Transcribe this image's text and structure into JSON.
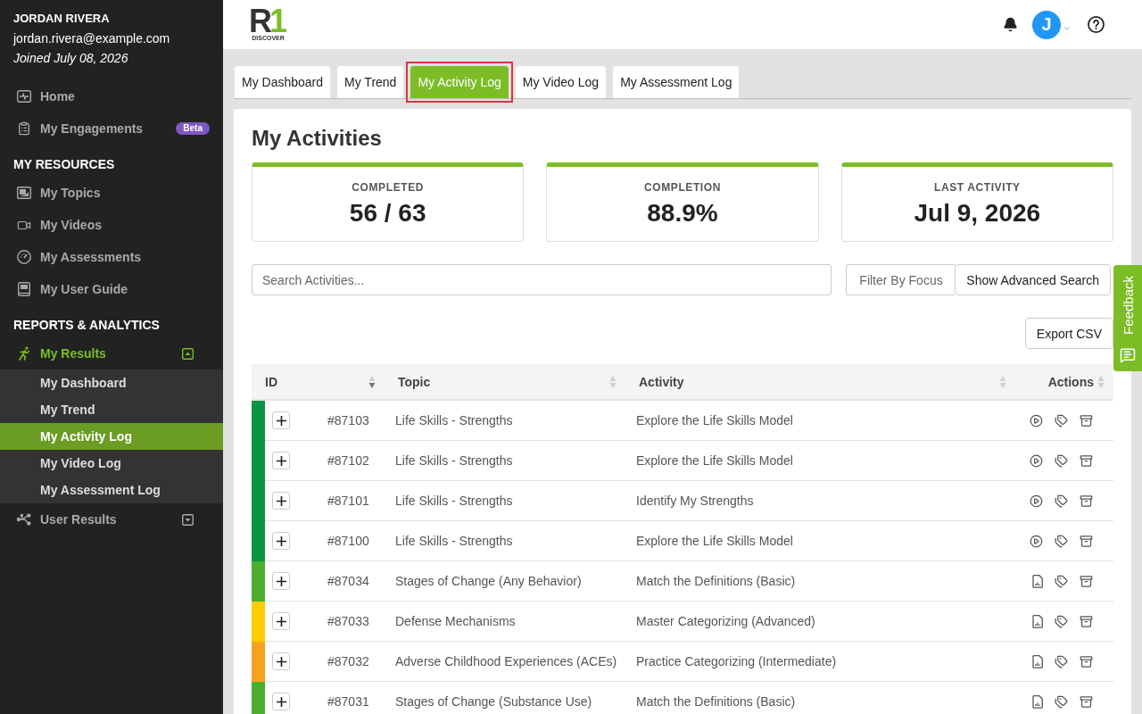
{
  "sidebar": {
    "user": {
      "name": "JORDAN RIVERA",
      "email": "jordan.rivera@example.com",
      "joined": "Joined July 08, 2026"
    },
    "sections": [
      {
        "items": [
          {
            "label": "Home",
            "selected": false
          },
          {
            "label": "My Engagements",
            "selected": false,
            "badge": "Beta"
          }
        ]
      },
      {
        "title": "MY RESOURCES",
        "items": [
          {
            "label": "My Topics",
            "selected": false
          },
          {
            "label": "My Videos",
            "selected": false
          },
          {
            "label": "My Assessments",
            "selected": false
          },
          {
            "label": "My User Guide",
            "selected": false
          }
        ]
      },
      {
        "title": "REPORTS & ANALYTICS",
        "items": [
          {
            "label": "My Results",
            "selected": true,
            "expanded": true,
            "children": [
              {
                "label": "My Dashboard",
                "selected": false
              },
              {
                "label": "My Trend",
                "selected": false
              },
              {
                "label": "My Activity Log",
                "selected": true
              },
              {
                "label": "My Video Log",
                "selected": false
              },
              {
                "label": "My Assessment Log",
                "selected": false
              }
            ]
          },
          {
            "label": "User Results",
            "selected": false,
            "expanded": false
          }
        ]
      }
    ]
  },
  "header": {
    "logo": {
      "letters": [
        {
          "char": "R",
          "color": "#333333"
        },
        {
          "char": "1",
          "color": "#7cbd26"
        }
      ],
      "wordmark": "DISCOVER"
    },
    "avatar_initial": "J"
  },
  "tabs": [
    {
      "label": "My Dashboard",
      "selected": false,
      "outlined": false
    },
    {
      "label": "My Trend",
      "selected": false,
      "outlined": false
    },
    {
      "label": "My Activity Log",
      "selected": true,
      "outlined": true
    },
    {
      "label": "My Video Log",
      "selected": false,
      "outlined": false
    },
    {
      "label": "My Assessment Log",
      "selected": false,
      "outlined": false
    }
  ],
  "page_title": "My Activities",
  "stats": [
    {
      "label": "COMPLETED",
      "value": "56 / 63"
    },
    {
      "label": "COMPLETION",
      "value": "88.9%"
    },
    {
      "label": "LAST ACTIVITY",
      "value": "Jul 9, 2026"
    }
  ],
  "search": {
    "placeholder": "Search Activities..."
  },
  "filter": {
    "placeholder": "Filter By Focus"
  },
  "buttons": {
    "advanced_search": "Show Advanced Search",
    "export": "Export CSV"
  },
  "table": {
    "columns": [
      {
        "label": "ID",
        "sorted": true
      },
      {
        "label": "Topic",
        "sorted": false
      },
      {
        "label": "Activity",
        "sorted": false
      },
      {
        "label": "Actions",
        "sorted": false
      }
    ],
    "rows": [
      {
        "id": "#87103",
        "topic": "Life Skills - Strengths",
        "activity": "Explore the Life Skills Model",
        "color": "#0b9444",
        "kind": "video"
      },
      {
        "id": "#87102",
        "topic": "Life Skills - Strengths",
        "activity": "Explore the Life Skills Model",
        "color": "#0b9444",
        "kind": "video"
      },
      {
        "id": "#87101",
        "topic": "Life Skills - Strengths",
        "activity": "Identify My Strengths",
        "color": "#0b9444",
        "kind": "video"
      },
      {
        "id": "#87100",
        "topic": "Life Skills - Strengths",
        "activity": "Explore the Life Skills Model",
        "color": "#0b9444",
        "kind": "video"
      },
      {
        "id": "#87034",
        "topic": "Stages of Change (Any Behavior)",
        "activity": "Match the Definitions (Basic)",
        "color": "#4cae2f",
        "kind": "document"
      },
      {
        "id": "#87033",
        "topic": "Defense Mechanisms",
        "activity": "Master Categorizing (Advanced)",
        "color": "#fecc00",
        "kind": "document"
      },
      {
        "id": "#87032",
        "topic": "Adverse Childhood Experiences (ACEs)",
        "activity": "Practice Categorizing (Intermediate)",
        "color": "#f7a21f",
        "kind": "document"
      },
      {
        "id": "#87031",
        "topic": "Stages of Change (Substance Use)",
        "activity": "Match the Definitions (Basic)",
        "color": "#4cae2f",
        "kind": "document"
      }
    ]
  },
  "feedback": {
    "label": "Feedback"
  }
}
